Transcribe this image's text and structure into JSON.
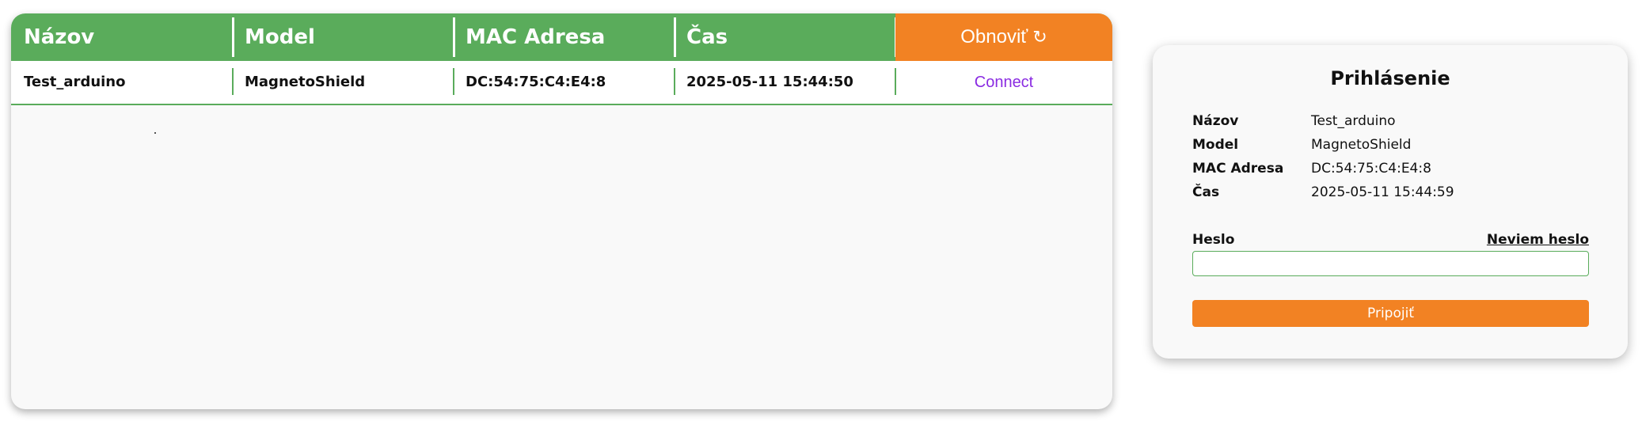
{
  "table": {
    "headers": [
      "Názov",
      "Model",
      "MAC Adresa",
      "Čas"
    ],
    "refresh_label": "Obnoviť",
    "refresh_icon": "↻",
    "rows": [
      {
        "name": "Test_arduino",
        "model": "MagnetoShield",
        "mac": "DC:54:75:C4:E4:8",
        "time": "2025-05-11 15:44:50",
        "action": "Connect"
      }
    ]
  },
  "login": {
    "title": "Prihlásenie",
    "info": [
      {
        "label": "Názov",
        "value": "Test_arduino"
      },
      {
        "label": "Model",
        "value": "MagnetoShield"
      },
      {
        "label": "MAC Adresa",
        "value": "DC:54:75:C4:E4:8"
      },
      {
        "label": "Čas",
        "value": "2025-05-11 15:44:59"
      }
    ],
    "password_label": "Heslo",
    "forgot_label": "Neviem heslo",
    "password_value": "",
    "submit_label": "Pripojiť"
  },
  "colors": {
    "header_green": "#5aac5b",
    "accent_orange": "#f28223",
    "link_purple": "#8a2be2"
  }
}
